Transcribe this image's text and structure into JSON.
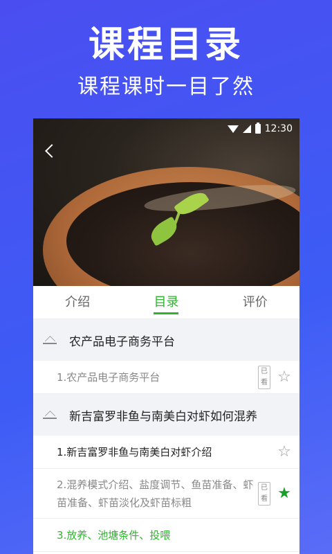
{
  "promo": {
    "title": "课程目录",
    "subtitle": "课程课时一目了然"
  },
  "status_bar": {
    "time": "12:30"
  },
  "tabs": [
    {
      "label": "介绍",
      "active": false
    },
    {
      "label": "目录",
      "active": true
    },
    {
      "label": "评价",
      "active": false
    }
  ],
  "chapters": [
    {
      "title": "农产品电子商务平台",
      "lessons": [
        {
          "title": "1.农产品电子商务平台",
          "watched_badge": "已看",
          "starred": false
        }
      ]
    },
    {
      "title": "新吉富罗非鱼与南美白对虾如何混养",
      "lessons": [
        {
          "title": "1.新吉富罗非鱼与南美白对虾介绍",
          "starred": false
        },
        {
          "title": "2.混养模式介绍、盐度调节、鱼苗准备、虾苗准备、虾苗淡化及虾苗标粗",
          "watched_badge": "已看",
          "starred": true
        },
        {
          "title": "3.放养、池塘条件、投喂",
          "playing": true
        }
      ]
    }
  ],
  "colors": {
    "accent_green": "#2db52d",
    "background_blue": "#4a4ef0"
  }
}
